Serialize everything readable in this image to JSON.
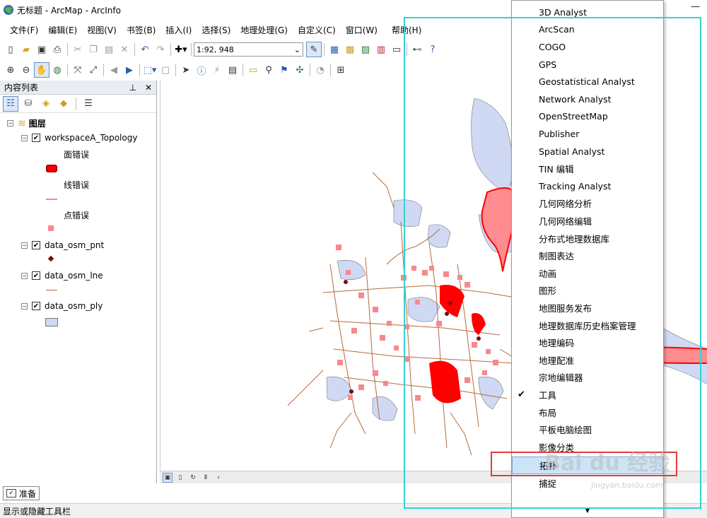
{
  "window": {
    "title": "无标题 - ArcMap - ArcInfo"
  },
  "menubar": {
    "items": [
      "文件(F)",
      "编辑(E)",
      "视图(V)",
      "书签(B)",
      "插入(I)",
      "选择(S)",
      "地理处理(G)",
      "自定义(C)",
      "窗口(W)",
      "帮助(H)"
    ]
  },
  "toolbar": {
    "scale": "1:92, 948"
  },
  "toc": {
    "title": "内容列表",
    "root_label": "图层",
    "layers": [
      {
        "name": "workspaceA_Topology",
        "sublabels": [
          "面错误",
          "线错误",
          "点错误"
        ],
        "checked": true
      },
      {
        "name": "data_osm_pnt",
        "checked": true
      },
      {
        "name": "data_osm_lne",
        "checked": true
      },
      {
        "name": "data_osm_ply",
        "checked": true
      }
    ]
  },
  "dropdown": {
    "items": [
      "3D Analyst",
      "ArcScan",
      "COGO",
      "GPS",
      "Geostatistical Analyst",
      "Network Analyst",
      "OpenStreetMap",
      "Publisher",
      "Spatial Analyst",
      "TIN 编辑",
      "Tracking Analyst",
      "几何网络分析",
      "几何网络编辑",
      "分布式地理数据库",
      "制图表达",
      "动画",
      "图形",
      "地图服务发布",
      "地理数据库历史档案管理",
      "地理编码",
      "地理配准",
      "宗地编辑器",
      "工具",
      "布局",
      "平板电脑绘图",
      "影像分类",
      "拓扑",
      "捕捉"
    ],
    "checked_item": "工具",
    "highlighted_item": "拓扑"
  },
  "status": {
    "tab_label": "准备",
    "text": "显示或隐藏工具栏"
  },
  "watermark": {
    "brand": "Bai du 经验",
    "url": "jingyan.baidu.com"
  },
  "colors": {
    "topology_error_red": "#ff0000",
    "error_pink": "#f8888a",
    "polygon_fill": "#cfd9f3",
    "line_brown": "#b76a3c",
    "point_dark": "#6b1212",
    "highlight_cyan": "#35d1d1",
    "highlight_red": "#e23b3b"
  }
}
